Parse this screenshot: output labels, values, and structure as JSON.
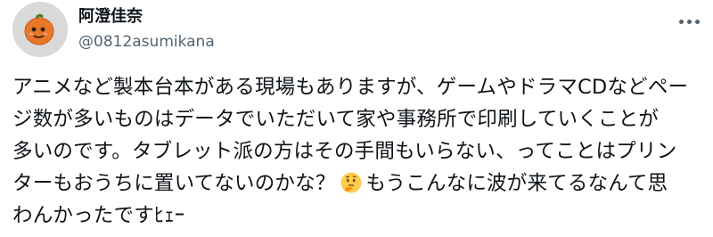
{
  "tweet": {
    "display_name": "阿澄佳奈",
    "handle": "@0812asumikana",
    "more_icon": "more-horizontal-icon",
    "avatar_icon": "avatar-image",
    "text_lines": [
      "アニメなど製本台本がある現場もありますが、ゲームやドラマCDなどペー",
      "ジ数が多いものはデータでいただいて家や事務所で印刷していくことが",
      "多いのです。タブレット派の方はその手間もいらない、ってことはプリン",
      "ターもおうちに置いてないのかな？",
      "もうこんなに波が来てるなんて思",
      "わんかったですﾋｪｰ"
    ],
    "emoji": "thinking-face-emoji"
  }
}
